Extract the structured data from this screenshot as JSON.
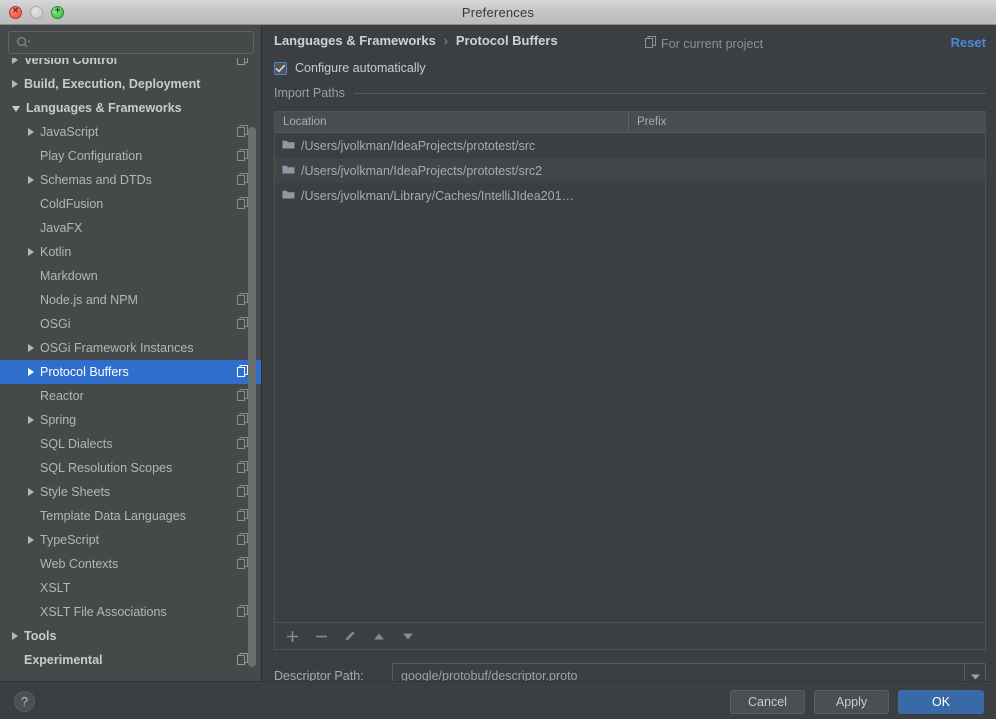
{
  "window": {
    "title": "Preferences",
    "traffic_lights": [
      {
        "name": "close-button",
        "glyph": "×"
      },
      {
        "name": "minimize-button",
        "glyph": "−"
      },
      {
        "name": "zoom-button",
        "glyph": "+"
      }
    ]
  },
  "sidebar": {
    "search": {
      "value": "",
      "placeholder": ""
    },
    "tree": [
      {
        "label": "Version Control",
        "level": 0,
        "arrow": "right",
        "bold": true,
        "project": true,
        "selected": false,
        "clipped": true
      },
      {
        "label": "Build, Execution, Deployment",
        "level": 0,
        "arrow": "right",
        "bold": true,
        "project": false,
        "selected": false
      },
      {
        "label": "Languages & Frameworks",
        "level": 0,
        "arrow": "down",
        "bold": true,
        "project": false,
        "selected": false
      },
      {
        "label": "JavaScript",
        "level": 1,
        "arrow": "right",
        "bold": false,
        "project": true,
        "selected": false
      },
      {
        "label": "Play Configuration",
        "level": 1,
        "arrow": "none",
        "bold": false,
        "project": true,
        "selected": false
      },
      {
        "label": "Schemas and DTDs",
        "level": 1,
        "arrow": "right",
        "bold": false,
        "project": true,
        "selected": false
      },
      {
        "label": "ColdFusion",
        "level": 1,
        "arrow": "none",
        "bold": false,
        "project": true,
        "selected": false
      },
      {
        "label": "JavaFX",
        "level": 1,
        "arrow": "none",
        "bold": false,
        "project": false,
        "selected": false
      },
      {
        "label": "Kotlin",
        "level": 1,
        "arrow": "right",
        "bold": false,
        "project": false,
        "selected": false
      },
      {
        "label": "Markdown",
        "level": 1,
        "arrow": "none",
        "bold": false,
        "project": false,
        "selected": false
      },
      {
        "label": "Node.js and NPM",
        "level": 1,
        "arrow": "none",
        "bold": false,
        "project": true,
        "selected": false
      },
      {
        "label": "OSGi",
        "level": 1,
        "arrow": "none",
        "bold": false,
        "project": true,
        "selected": false
      },
      {
        "label": "OSGi Framework Instances",
        "level": 1,
        "arrow": "right",
        "bold": false,
        "project": false,
        "selected": false
      },
      {
        "label": "Protocol Buffers",
        "level": 1,
        "arrow": "right",
        "bold": false,
        "project": true,
        "selected": true
      },
      {
        "label": "Reactor",
        "level": 1,
        "arrow": "none",
        "bold": false,
        "project": true,
        "selected": false
      },
      {
        "label": "Spring",
        "level": 1,
        "arrow": "right",
        "bold": false,
        "project": true,
        "selected": false
      },
      {
        "label": "SQL Dialects",
        "level": 1,
        "arrow": "none",
        "bold": false,
        "project": true,
        "selected": false
      },
      {
        "label": "SQL Resolution Scopes",
        "level": 1,
        "arrow": "none",
        "bold": false,
        "project": true,
        "selected": false
      },
      {
        "label": "Style Sheets",
        "level": 1,
        "arrow": "right",
        "bold": false,
        "project": true,
        "selected": false
      },
      {
        "label": "Template Data Languages",
        "level": 1,
        "arrow": "none",
        "bold": false,
        "project": true,
        "selected": false
      },
      {
        "label": "TypeScript",
        "level": 1,
        "arrow": "right",
        "bold": false,
        "project": true,
        "selected": false
      },
      {
        "label": "Web Contexts",
        "level": 1,
        "arrow": "none",
        "bold": false,
        "project": true,
        "selected": false
      },
      {
        "label": "XSLT",
        "level": 1,
        "arrow": "none",
        "bold": false,
        "project": false,
        "selected": false
      },
      {
        "label": "XSLT File Associations",
        "level": 1,
        "arrow": "none",
        "bold": false,
        "project": true,
        "selected": false
      },
      {
        "label": "Tools",
        "level": 0,
        "arrow": "right",
        "bold": true,
        "project": false,
        "selected": false
      },
      {
        "label": "Experimental",
        "level": 0,
        "arrow": "none",
        "bold": true,
        "project": true,
        "selected": false
      }
    ]
  },
  "main": {
    "breadcrumb": {
      "parent": "Languages & Frameworks",
      "separator": "›",
      "current": "Protocol Buffers"
    },
    "for_current_project": "For current project",
    "reset_label": "Reset",
    "configure_automatically": {
      "label": "Configure automatically",
      "checked": true,
      "check_glyph": "✓"
    },
    "import_paths_title": "Import Paths",
    "table": {
      "columns": [
        "Location",
        "Prefix"
      ],
      "rows": [
        {
          "location": "/Users/jvolkman/IdeaProjects/prototest/src",
          "prefix": ""
        },
        {
          "location": "/Users/jvolkman/IdeaProjects/prototest/src2",
          "prefix": ""
        },
        {
          "location": "/Users/jvolkman/Library/Caches/IntelliJIdea201…",
          "prefix": ""
        }
      ],
      "toolbar": [
        {
          "name": "add-import-path-button",
          "glyph": "+"
        },
        {
          "name": "remove-import-path-button",
          "glyph": "−"
        },
        {
          "name": "edit-import-path-button",
          "glyph": "pencil"
        },
        {
          "name": "move-up-button",
          "glyph": "▲"
        },
        {
          "name": "move-down-button",
          "glyph": "▼"
        }
      ]
    },
    "descriptor_path": {
      "label": "Descriptor Path:",
      "value": "google/protobuf/descriptor.proto",
      "placeholder": ""
    }
  },
  "footer": {
    "help_glyph": "?",
    "buttons": [
      {
        "name": "cancel-button",
        "label": "Cancel",
        "primary": false
      },
      {
        "name": "apply-button",
        "label": "Apply",
        "primary": false
      },
      {
        "name": "ok-button",
        "label": "OK",
        "primary": true
      }
    ]
  },
  "colors": {
    "accent": "#2f6ecd",
    "link": "#4d88d8",
    "primary_button": "#3a69a8",
    "panel_bg": "#3c3f41",
    "sidebar_bg": "#45494a"
  }
}
